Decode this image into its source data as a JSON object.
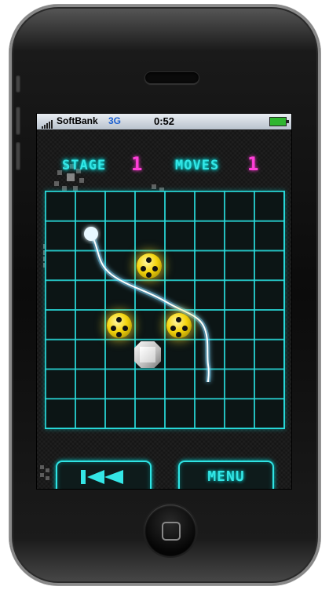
{
  "status_bar": {
    "carrier": "SoftBank",
    "network": "3G",
    "time": "0:52"
  },
  "hud": {
    "stage_label": "STAGE",
    "stage_value": "1",
    "moves_label": "MOVES",
    "moves_value": "1"
  },
  "board": {
    "columns": 8,
    "rows": 8,
    "ball_cells": [
      [
        3,
        2
      ],
      [
        2,
        4
      ],
      [
        4,
        4
      ]
    ],
    "block_cell": [
      3,
      5
    ],
    "trail_start_cell": [
      1,
      1
    ],
    "trail_end_cell": [
      5,
      6
    ]
  },
  "controls": {
    "rewind_icon": "rewind-icon",
    "menu_label": "MENU"
  },
  "colors": {
    "grid": "#28dcdc",
    "hud_text": "#34e6e6",
    "hud_value": "#ff3fd8",
    "ball": "#f4d40c"
  }
}
